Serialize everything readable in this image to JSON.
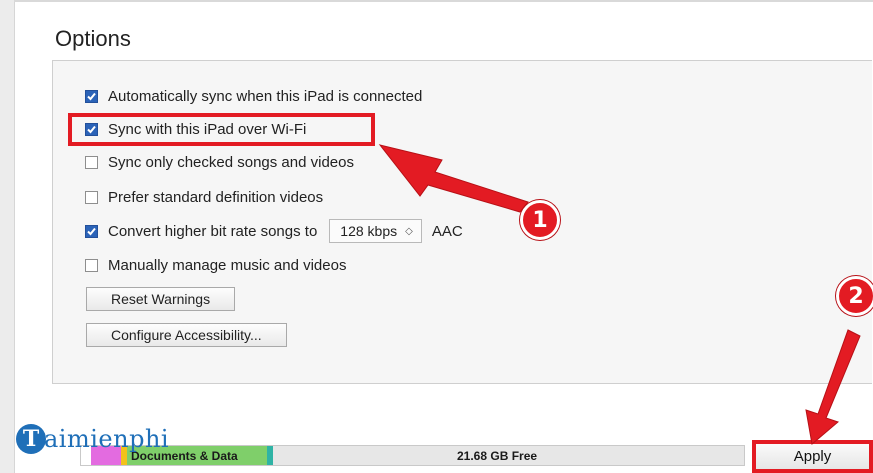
{
  "section": {
    "title": "Options"
  },
  "options": [
    {
      "label": "Automatically sync when this iPad is connected",
      "checked": true
    },
    {
      "label": "Sync with this iPad over Wi-Fi",
      "checked": true
    },
    {
      "label": "Sync only checked songs and videos",
      "checked": false
    },
    {
      "label": "Prefer standard definition videos",
      "checked": false
    },
    {
      "label": "Convert higher bit rate songs to",
      "checked": true
    },
    {
      "label": "Manually manage music and videos",
      "checked": false
    }
  ],
  "bitrate": {
    "selected": "128 kbps",
    "format": "AAC"
  },
  "buttons": {
    "reset_warnings": "Reset Warnings",
    "configure_accessibility": "Configure Accessibility..."
  },
  "storage": {
    "documents_label": "Documents & Data",
    "free_label": "21.68 GB Free"
  },
  "apply": {
    "label": "Apply"
  },
  "annotations": {
    "badge_1": "1",
    "badge_2": "2"
  },
  "watermark": {
    "logo_letter": "T",
    "text": "aimienphi"
  },
  "colors": {
    "highlight": "#e31b23",
    "checkbox": "#2b63b8",
    "storage_segments": [
      "#e36be0",
      "#f2c21a",
      "#7fcf6a",
      "#2fb3a5"
    ]
  }
}
